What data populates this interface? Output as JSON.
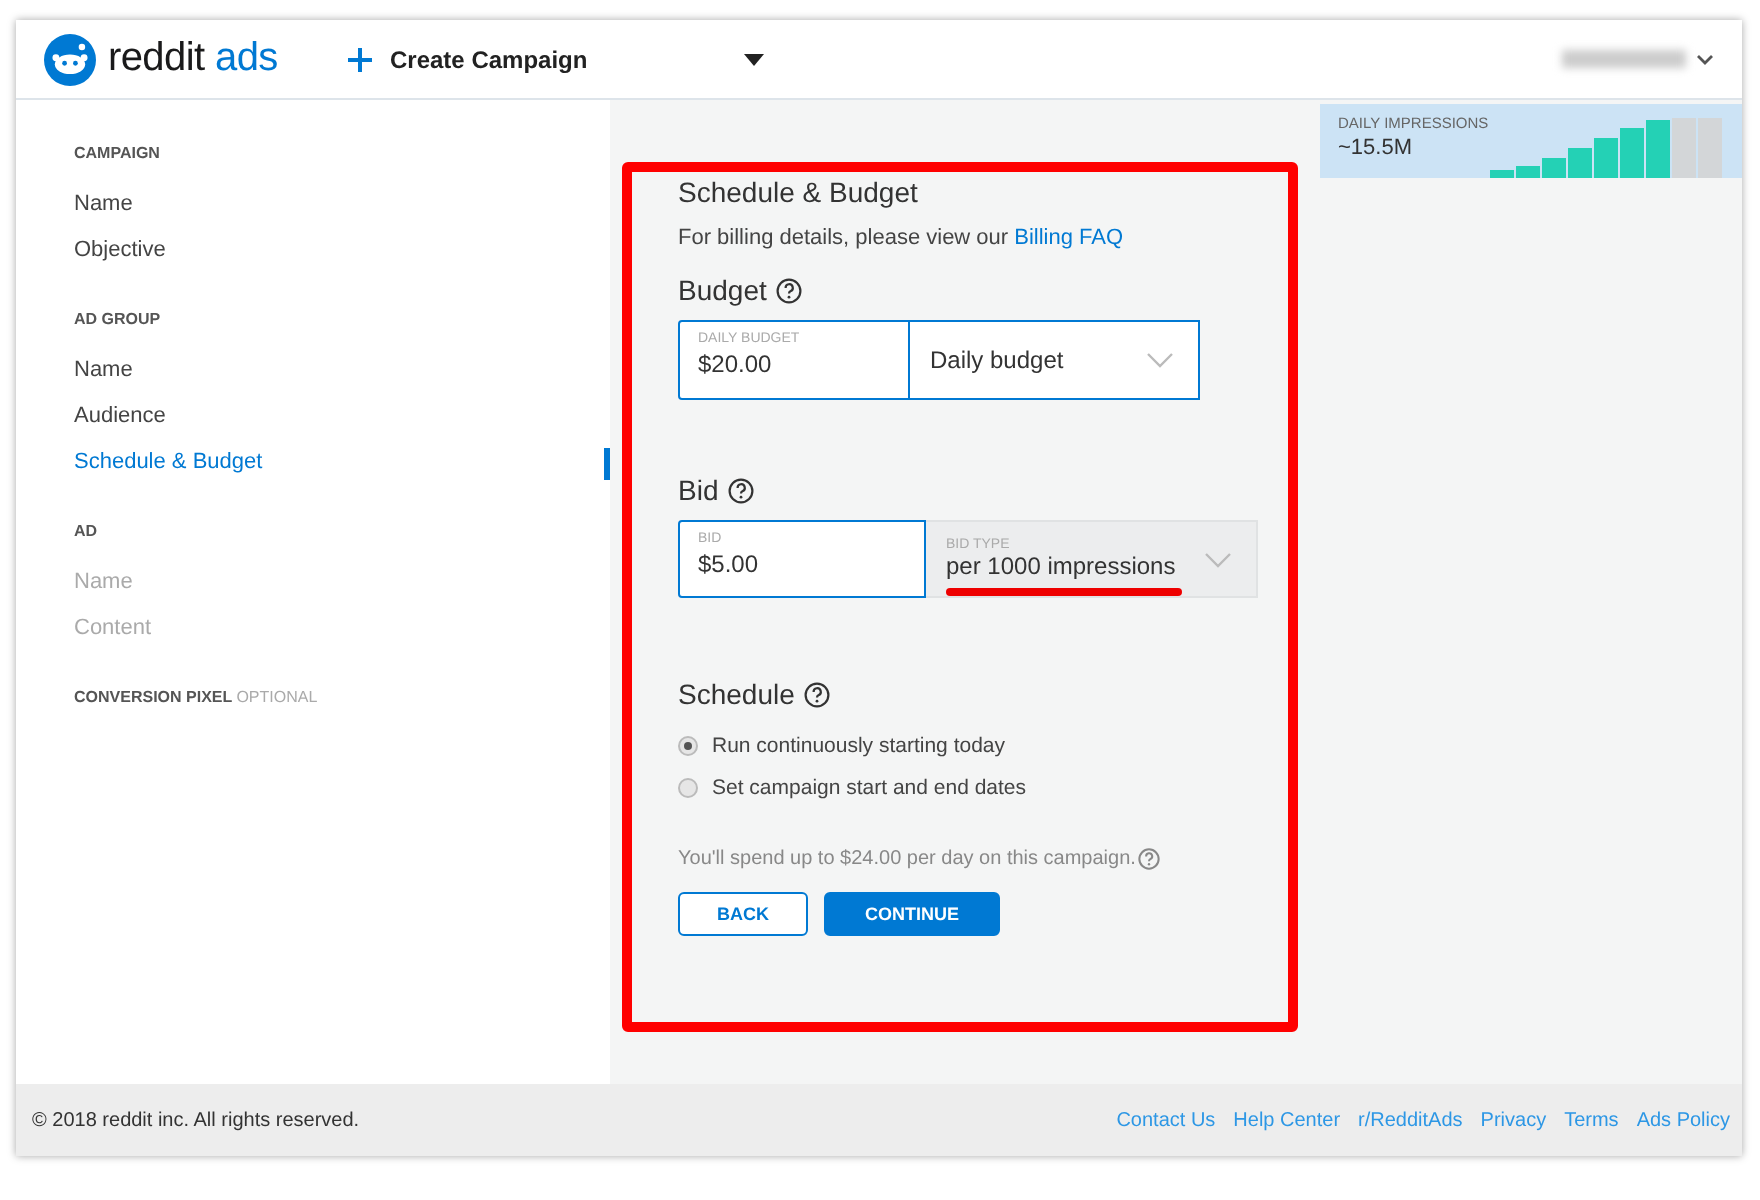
{
  "header": {
    "logo_text": "reddit",
    "logo_accent": "ads",
    "create_label": "Create Campaign"
  },
  "sidebar": {
    "sections": [
      {
        "title": "CAMPAIGN",
        "items": [
          {
            "label": "Name",
            "selected": false,
            "disabled": false
          },
          {
            "label": "Objective",
            "selected": false,
            "disabled": false
          }
        ]
      },
      {
        "title": "AD GROUP",
        "items": [
          {
            "label": "Name",
            "selected": false,
            "disabled": false
          },
          {
            "label": "Audience",
            "selected": false,
            "disabled": false
          },
          {
            "label": "Schedule & Budget",
            "selected": true,
            "disabled": false
          }
        ]
      },
      {
        "title": "AD",
        "items": [
          {
            "label": "Name",
            "selected": false,
            "disabled": true
          },
          {
            "label": "Content",
            "selected": false,
            "disabled": true
          }
        ]
      },
      {
        "title": "CONVERSION PIXEL",
        "note": "OPTIONAL"
      }
    ]
  },
  "form": {
    "title": "Schedule & Budget",
    "billing_text": "For billing details, please view our",
    "billing_link": "Billing FAQ",
    "budget": {
      "heading": "Budget",
      "field_label": "DAILY BUDGET",
      "value": "$20.00",
      "select_value": "Daily budget",
      "select_disabled": false
    },
    "bid": {
      "heading": "Bid",
      "field_label": "BID",
      "value": "$5.00",
      "select_label": "BID TYPE",
      "select_value": "per 1000 impressions",
      "select_disabled": true
    },
    "schedule": {
      "heading": "Schedule",
      "options": [
        {
          "label": "Run continuously starting today",
          "selected": true
        },
        {
          "label": "Set campaign start and end dates",
          "selected": false
        }
      ]
    },
    "note": "You'll spend up to $24.00 per day on this campaign.",
    "buttons": [
      {
        "label": "BACK",
        "kind": "secondary"
      },
      {
        "label": "CONTINUE",
        "kind": "primary"
      }
    ]
  },
  "impressions": {
    "label": "DAILY IMPRESSIONS",
    "value": "~15.5M"
  },
  "footer": {
    "copyright": "© 2018 reddit inc. All rights reserved.",
    "links": [
      "Contact Us",
      "Help Center",
      "r/RedditAds",
      "Privacy",
      "Terms",
      "Ads Policy"
    ]
  }
}
